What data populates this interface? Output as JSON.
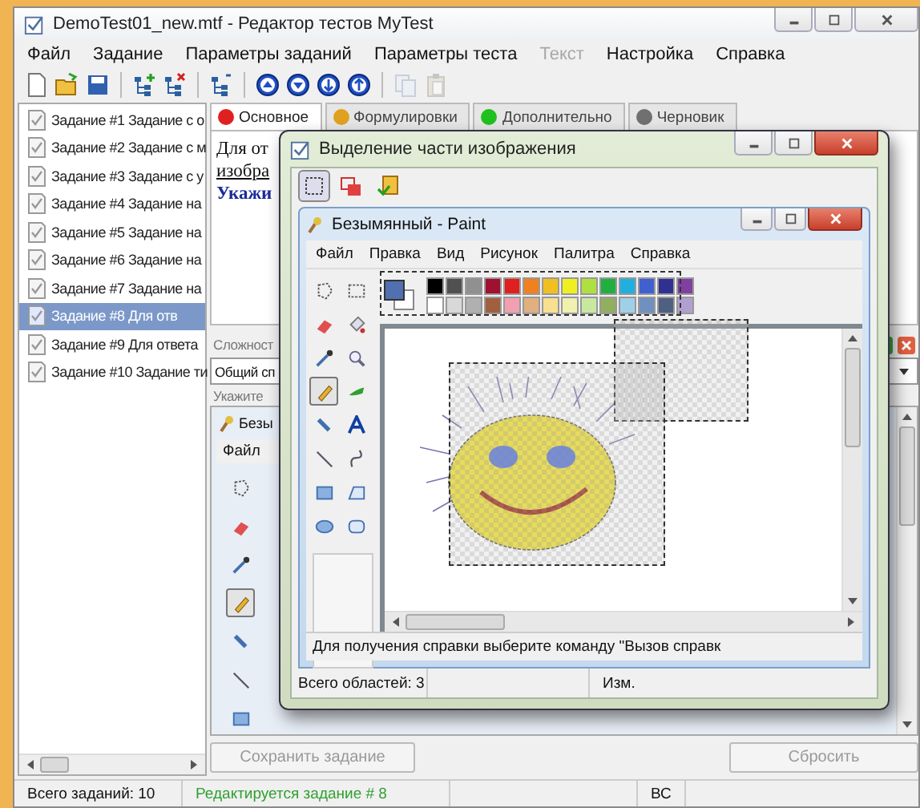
{
  "window": {
    "title": "DemoTest01_new.mtf - Редактор тестов MyTest"
  },
  "menu": [
    {
      "label": "Файл",
      "disabled": false
    },
    {
      "label": "Задание",
      "disabled": false
    },
    {
      "label": "Параметры заданий",
      "disabled": false
    },
    {
      "label": "Параметры теста",
      "disabled": false
    },
    {
      "label": "Текст",
      "disabled": true
    },
    {
      "label": "Настройка",
      "disabled": false
    },
    {
      "label": "Справка",
      "disabled": false
    }
  ],
  "toolbar": [
    {
      "kind": "new",
      "disabled": false
    },
    {
      "kind": "open",
      "disabled": false
    },
    {
      "kind": "save",
      "disabled": false
    },
    {
      "kind": "separator"
    },
    {
      "kind": "add-task",
      "disabled": false
    },
    {
      "kind": "delete-task",
      "disabled": false
    },
    {
      "kind": "separator"
    },
    {
      "kind": "tree",
      "disabled": false
    },
    {
      "kind": "separator"
    },
    {
      "kind": "move-up",
      "disabled": false
    },
    {
      "kind": "move-down",
      "disabled": false
    },
    {
      "kind": "move-in",
      "disabled": false
    },
    {
      "kind": "move-out",
      "disabled": false
    },
    {
      "kind": "separator"
    },
    {
      "kind": "copy",
      "disabled": true
    },
    {
      "kind": "paste",
      "disabled": true
    }
  ],
  "tasks": [
    {
      "label": "Задание #1 Задание с о",
      "selected": false
    },
    {
      "label": "Задание #2 Задание с м",
      "selected": false
    },
    {
      "label": "Задание #3 Задание с у",
      "selected": false
    },
    {
      "label": "Задание #4 Задание на",
      "selected": false
    },
    {
      "label": "Задание #5 Задание на",
      "selected": false
    },
    {
      "label": "Задание #6 Задание на",
      "selected": false
    },
    {
      "label": "Задание #7 Задание на",
      "selected": false
    },
    {
      "label": "Задание #8 Для отв",
      "selected": true
    },
    {
      "label": "Задание #9 Для ответа",
      "selected": false
    },
    {
      "label": "Задание #10 Задание ти",
      "selected": false
    }
  ],
  "tabs": [
    {
      "label": "Основное",
      "selected": true,
      "color": "#e02020"
    },
    {
      "label": "Формулировки",
      "selected": false,
      "color": "#e0a020"
    },
    {
      "label": "Дополнительно",
      "selected": false,
      "color": "#20c020"
    },
    {
      "label": "Черновик",
      "selected": false,
      "color": "#707070"
    }
  ],
  "question": [
    {
      "text": "Для от",
      "kind": "plain"
    },
    {
      "text": "изобра",
      "kind": "underlined"
    },
    {
      "text": "Укажи",
      "kind": "emphasis"
    }
  ],
  "difficulty_label": "Сложност",
  "list_select": {
    "value": "Общий сп"
  },
  "hint_label": "Укажите",
  "embedded_paint": {
    "title": "Безы",
    "menu": "Файл"
  },
  "buttons": [
    {
      "label": "Сохранить задание",
      "disabled": true
    },
    {
      "label": "Сбросить",
      "disabled": true
    }
  ],
  "status_bar": {
    "total": "Всего заданий: 10",
    "editing": "Редактируется задание # 8",
    "mode": "ВС"
  },
  "dialog": {
    "title": "Выделение части изображения",
    "tools": [
      {
        "kind": "rect-select",
        "selected": true
      },
      {
        "kind": "delete-area",
        "selected": false
      },
      {
        "kind": "apply",
        "selected": false
      }
    ],
    "status": [
      "Всего областей: 3",
      "Изм."
    ]
  },
  "paint": {
    "title": "Безымянный - Paint",
    "menu": [
      "Файл",
      "Правка",
      "Вид",
      "Рисунок",
      "Палитра",
      "Справка"
    ],
    "tools": [
      {
        "kind": "free-select",
        "selected": false
      },
      {
        "kind": "rect-select",
        "selected": false
      },
      {
        "kind": "eraser",
        "selected": false
      },
      {
        "kind": "fill",
        "selected": false
      },
      {
        "kind": "picker",
        "selected": false
      },
      {
        "kind": "magnifier",
        "selected": false
      },
      {
        "kind": "pencil",
        "selected": true
      },
      {
        "kind": "brush",
        "selected": false
      },
      {
        "kind": "airbrush",
        "selected": false
      },
      {
        "kind": "text",
        "selected": false
      },
      {
        "kind": "line",
        "selected": false
      },
      {
        "kind": "curve",
        "selected": false
      },
      {
        "kind": "rectangle",
        "selected": false
      },
      {
        "kind": "polygon",
        "selected": false
      },
      {
        "kind": "ellipse",
        "selected": false
      },
      {
        "kind": "rounded-rect",
        "selected": false
      }
    ],
    "palette": [
      {
        "color": "#000000"
      },
      {
        "color": "#505050"
      },
      {
        "color": "#909090"
      },
      {
        "color": "#a01030"
      },
      {
        "color": "#e02020"
      },
      {
        "color": "#f08020"
      },
      {
        "color": "#f0c020"
      },
      {
        "color": "#f0f020"
      },
      {
        "color": "#b0e040"
      },
      {
        "color": "#20b040"
      },
      {
        "color": "#20b0e0"
      },
      {
        "color": "#4060d0"
      },
      {
        "color": "#303090"
      },
      {
        "color": "#8040a0"
      },
      {
        "color": "#ffffff"
      },
      {
        "color": "#d8d8d8"
      },
      {
        "color": "#b0b0b0"
      },
      {
        "color": "#a06040"
      },
      {
        "color": "#f0a0b0"
      },
      {
        "color": "#e0b080"
      },
      {
        "color": "#f8e090"
      },
      {
        "color": "#f0f0b0"
      },
      {
        "color": "#c8e8a0"
      },
      {
        "color": "#90b060"
      },
      {
        "color": "#a0d0e8"
      },
      {
        "color": "#7090c0"
      },
      {
        "color": "#506080"
      },
      {
        "color": "#b0a0d0"
      }
    ],
    "status": "Для получения справки выберите команду \"Вызов справк"
  }
}
